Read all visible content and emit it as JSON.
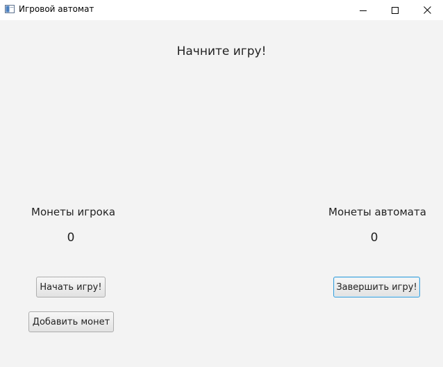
{
  "window": {
    "title": "Игровой автомат",
    "icon": "app-window-icon",
    "controls": [
      "minimize-icon",
      "maximize-icon",
      "close-icon"
    ]
  },
  "game": {
    "status": "Начните игру!",
    "player": {
      "label": "Монеты игрока",
      "coins": "0"
    },
    "machine": {
      "label": "Монеты автомата",
      "coins": "0"
    }
  },
  "buttons": {
    "start": "Начать игру!",
    "finish": "Завершить игру!",
    "add_coins": "Добавить монет"
  },
  "colors": {
    "background": "#f3f3f3",
    "focus_border": "#3c9fd8"
  }
}
